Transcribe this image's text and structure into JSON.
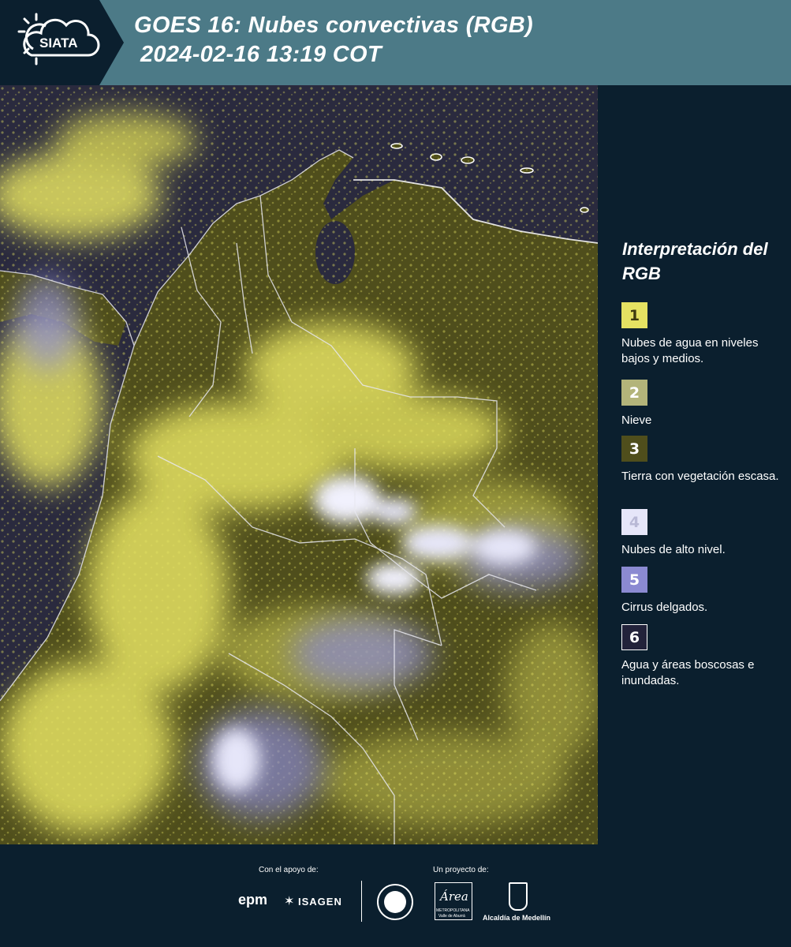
{
  "header": {
    "logo_text": "SIATA",
    "title_line1": "GOES 16: Nubes convectivas (RGB)",
    "title_line2": "2024-02-16 13:19 COT"
  },
  "legend": {
    "title": "Interpretación del RGB",
    "items": [
      {
        "number": "1",
        "label": "Nubes de agua en niveles bajos y medios.",
        "color": "#e5e262",
        "text_color": "#3d3a10"
      },
      {
        "number": "2",
        "label": "Nieve",
        "color": "#b3b47a",
        "text_color": "#ffffff"
      },
      {
        "number": "3",
        "label": "Tierra con vegetación escasa.",
        "color": "#4f4e1c",
        "text_color": "#ffffff"
      },
      {
        "number": "4",
        "label": "Nubes de alto nivel.",
        "color": "#e6e6f9",
        "text_color": "#b9b9d6"
      },
      {
        "number": "5",
        "label": "Cirrus delgados.",
        "color": "#8b8ad2",
        "text_color": "#ffffff"
      },
      {
        "number": "6",
        "label": "Agua y áreas boscosas e inundadas.",
        "color": "#22223a",
        "text_color": "#ffffff"
      }
    ]
  },
  "footer": {
    "support_label": "Con el apoyo de:",
    "project_label": "Un proyecto de:",
    "epm": "epm",
    "isagen": "ISAGEN",
    "area_name": "Área",
    "area_sub1": "METROPOLITANA",
    "area_sub2": "Valle de Aburrá",
    "alcaldia": "Alcaldía de Medellín"
  },
  "colors": {
    "header_bg": "#4c7a87",
    "logo_bg": "#0b1f2e",
    "panel_bg": "#0b1f2e",
    "map_dark": "#2a2a3e",
    "land": "#4f4e1c",
    "low_clouds": "#e5e262",
    "high_clouds": "#e6e6f9",
    "cirrus": "#8b8ad2"
  }
}
